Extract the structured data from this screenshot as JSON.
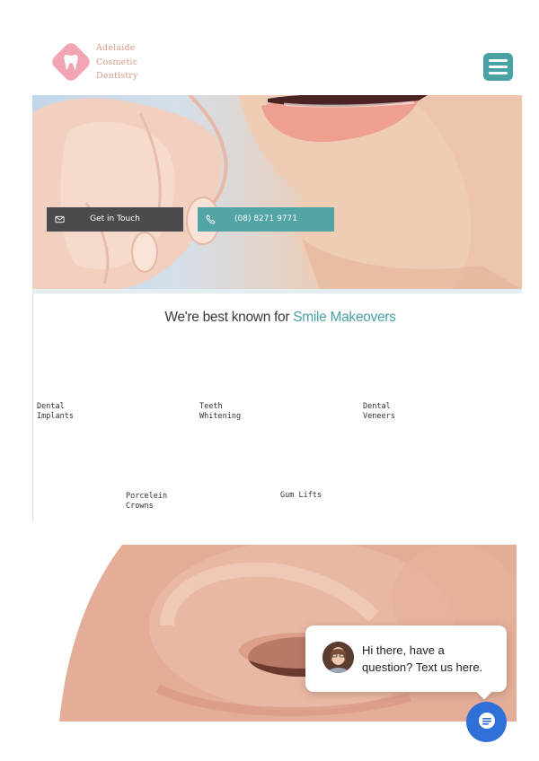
{
  "header": {
    "logo_lines": [
      "Adelaide",
      "Cosmetic",
      "Dentistry"
    ],
    "logo_icon": "tooth-icon",
    "menu_icon": "hamburger-icon"
  },
  "hero": {
    "contact_button": {
      "label": "Get in Touch",
      "icon": "envelope-icon"
    },
    "phone_button": {
      "label": "(08) 8271 9771",
      "icon": "phone-icon"
    }
  },
  "section": {
    "title_prefix": "We're best known for ",
    "title_highlight": "Smile Makeovers"
  },
  "services": [
    {
      "line1": "Dental",
      "line2": "Implants"
    },
    {
      "line1": "Teeth",
      "line2": "Whitening"
    },
    {
      "line1": "Dental",
      "line2": "Veneers"
    },
    {
      "line1": "Porcelein",
      "line2": "Crowns"
    },
    {
      "line1": "Gum Lifts",
      "line2": ""
    }
  ],
  "chat": {
    "message_line1": "Hi there, have a",
    "message_line2": "question? Text us here.",
    "fab_icon": "chat-icon"
  },
  "colors": {
    "accent": "#4ba2a4",
    "dark_button": "#4b4b4f",
    "logo_pink": "#f2a5b4",
    "logo_text": "#d79a8b",
    "chat_blue": "#2f6fd8"
  }
}
